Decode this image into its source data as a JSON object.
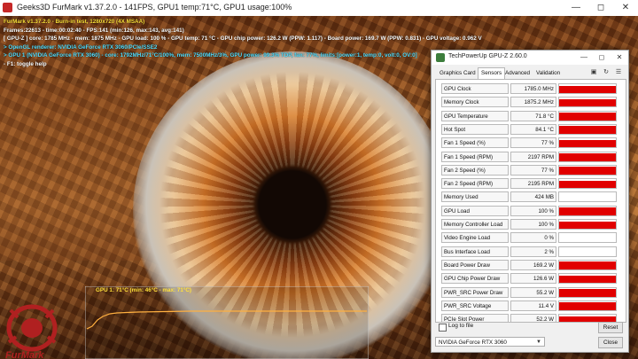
{
  "furmark": {
    "title": "Geeks3D FurMark v1.37.2.0 - 141FPS, GPU1 temp:71°C, GPU1 usage:100%",
    "osd": [
      {
        "text": "FurMark v1.37.2.0 - Burn-in test, 1280x720 (4X MSAA)",
        "color": "#ffe23a"
      },
      {
        "text": "Frames:22613 - time:00:02:40 - FPS:141 (min:126, max:143, avg:141)",
        "color": "#ffffff"
      },
      {
        "text": "[ GPU-Z ] core: 1785 MHz - mem: 1875 MHz - GPU load: 100 % - GPU temp: 71 °C - GPU chip power: 126.2 W (PPW: 1.117) - Board power: 169.7 W (PPW: 0.831) - GPU voltage: 0.962 V",
        "color": "#ffffff"
      },
      {
        "text": "> OpenGL renderer: NVIDIA GeForce RTX 3060/PCIe/SSE2",
        "color": "#55e0ff"
      },
      {
        "text": "> GPU 1 (NVIDIA GeForce RTX 3060) - core: 1792MHz/71°C/100%, mem: 7500MHz/3%, GPU power: 99.3% TDP, fan: 77%, limits:[power:1, temp:0, volt:0, OV:0]",
        "color": "#55e0ff"
      },
      {
        "text": "- F1: toggle help",
        "color": "#ffffff"
      }
    ],
    "graph_label": "GPU 1: 71°C (min: 46°C - max: 71°C)",
    "logo_text": "FurMark"
  },
  "gpuz": {
    "title": "TechPowerUp GPU-Z 2.60.0",
    "tabs": [
      "Graphics Card",
      "Sensors",
      "Advanced",
      "Validation"
    ],
    "active_tab": "Sensors",
    "sensors": [
      {
        "name": "GPU Clock",
        "value": "1785.0 MHz",
        "level": 0.85
      },
      {
        "name": "Memory Clock",
        "value": "1875.2 MHz",
        "level": 0.85
      },
      {
        "name": "GPU Temperature",
        "value": "71.8 °C",
        "level": 0.85
      },
      {
        "name": "Hot Spot",
        "value": "84.1 °C",
        "level": 0.85
      },
      {
        "name": "Fan 1 Speed (%)",
        "value": "77 %",
        "level": 0.85
      },
      {
        "name": "Fan 1 Speed (RPM)",
        "value": "2197 RPM",
        "level": 0.85
      },
      {
        "name": "Fan 2 Speed (%)",
        "value": "77 %",
        "level": 0.85
      },
      {
        "name": "Fan 2 Speed (RPM)",
        "value": "2195 RPM",
        "level": 0.85
      },
      {
        "name": "Memory Used",
        "value": "424 MB",
        "level": 0.0
      },
      {
        "name": "GPU Load",
        "value": "100 %",
        "level": 0.85
      },
      {
        "name": "Memory Controller Load",
        "value": "100 %",
        "level": 0.85
      },
      {
        "name": "Video Engine Load",
        "value": "0 %",
        "level": 0.0
      },
      {
        "name": "Bus Interface Load",
        "value": "2 %",
        "level": 0.0
      },
      {
        "name": "Board Power Draw",
        "value": "169.2 W",
        "level": 0.85
      },
      {
        "name": "GPU Chip Power Draw",
        "value": "126.6 W",
        "level": 0.85
      },
      {
        "name": "PWR_SRC Power Draw",
        "value": "55.2 W",
        "level": 0.85
      },
      {
        "name": "PWR_SRC Voltage",
        "value": "11.4 V",
        "level": 0.85
      },
      {
        "name": "PCIe Slot Power",
        "value": "52.2 W",
        "level": 0.85
      }
    ],
    "log_to_file": "Log to file",
    "reset_label": "Reset",
    "close_label": "Close",
    "gpu_select": "NVIDIA GeForce RTX 3060",
    "fill_color": "#e10000"
  }
}
